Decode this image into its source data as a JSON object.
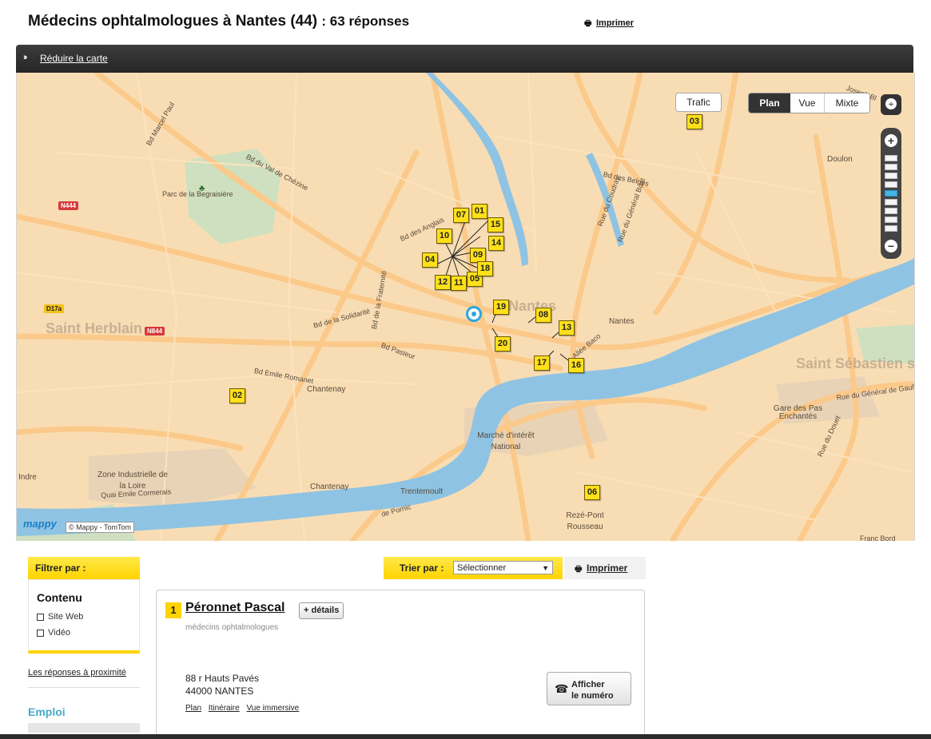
{
  "header": {
    "title": "Médecins ophtalmologues à Nantes (44)",
    "count": ": 63 réponses",
    "print_label": "Imprimer"
  },
  "mapbar": {
    "reduce_label": "Réduire la carte"
  },
  "map": {
    "controls": {
      "trafic": "Trafic",
      "plan": "Plan",
      "vue": "Vue",
      "mixte": "Mixte",
      "zoom_in": "+",
      "zoom_out": "−"
    },
    "zoom_level": "6 of 10 (from top)",
    "labels": {
      "park": "Parc de la Begraisière",
      "bd_marcel_paul": "Bd Marcel Paul",
      "bd_val_chezine": "Bd du Val de Chézine",
      "bd_anglais": "Bd des Anglais",
      "bd_fraternite": "Bd de la Fraternité",
      "bd_solidarite": "Bd de la Solidarité",
      "bd_pasteur": "Bd Pasteur",
      "bd_emile_romanet": "Bd Emile Romanet",
      "chantenay": "Chantenay",
      "chantenay2": "Chantenay",
      "nantes": "Nantes",
      "nantes_big": "Nantes",
      "doulon": "Doulon",
      "bd_belges": "Bd des Belges",
      "rue_coudray": "Rue du Coudray",
      "rue_general_buat": "Rue du Général Buat",
      "allee_baco": "Allée Baco",
      "saint_herblain": "Saint Herblain",
      "saint_sebastien": "Saint Sébastien sur Loire",
      "gare_pas_enchantes": "Gare des Pas Enchantés",
      "rue_general_gaulle": "Rue du Général de Gaulle",
      "rue_douet": "Rue du Douet",
      "marche_interet_national": "Marché d'intérêt National",
      "zone_industrielle": "Zone Industrielle de la Loire",
      "quai_emile_cormerais": "Quai Emile Cormerais",
      "indre": "Indre",
      "trentemoult": "Trentemoult",
      "reze_pont_rousseau": "Rezé-Pont Rousseau",
      "rue_pornic": "de Pornic",
      "joseph_bl": "Joseph Bl",
      "franc_bord": "Franc Bord",
      "n444": "N444",
      "n844": "N844",
      "d17a": "D17a"
    },
    "markers": [
      "01",
      "02",
      "03",
      "04",
      "05",
      "06",
      "07",
      "08",
      "09",
      "10",
      "11",
      "12",
      "13",
      "14",
      "15",
      "16",
      "17",
      "18",
      "19",
      "20"
    ],
    "logo": "mappy",
    "copyright": "© Mappy - TomTom"
  },
  "sidebar": {
    "filter_title": "Filtrer par :",
    "contenu": "Contenu",
    "options": [
      "Site Web",
      "Vidéo"
    ],
    "nearby_link": "Les réponses à proximité",
    "emploi": "Emploi"
  },
  "sort": {
    "label": "Trier par :",
    "selected": "Sélectionner",
    "print_label": "Imprimer"
  },
  "results": [
    {
      "index": "1",
      "name": "Péronnet Pascal",
      "details_button": "+ détails",
      "speciality": "médecins ophtalmologues",
      "street": "88 r Hauts Pavés",
      "city": "44000 NANTES",
      "links": [
        "Plan",
        "Itinéraire",
        "Vue immersive"
      ],
      "phone_button_line1": "Afficher",
      "phone_button_line2": "le numéro"
    }
  ],
  "colors": {
    "accent_yellow": "#ffd300",
    "map_background": "#f8ddb4",
    "river": "#8fc3e3",
    "road": "#fbc98a",
    "header_bar": "#2e2e2e",
    "emploi": "#4aa8c8"
  }
}
